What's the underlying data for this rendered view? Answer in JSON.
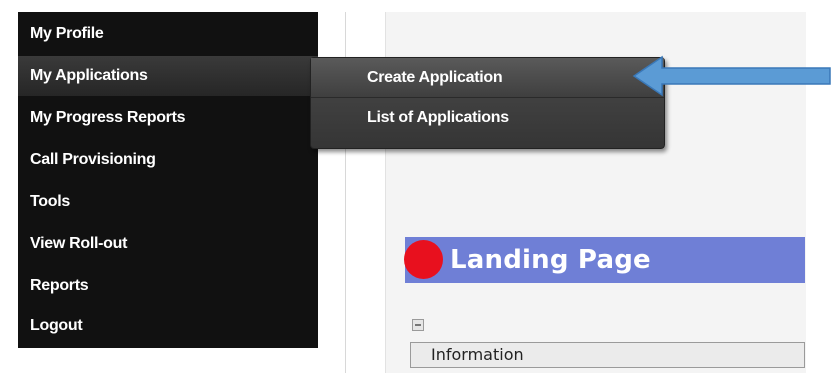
{
  "menu": {
    "items": [
      {
        "label": "My Profile"
      },
      {
        "label": "My Applications"
      },
      {
        "label": "My Progress Reports"
      },
      {
        "label": "Call Provisioning"
      },
      {
        "label": "Tools"
      },
      {
        "label": "View Roll-out"
      },
      {
        "label": "Reports"
      },
      {
        "label": "Logout"
      }
    ]
  },
  "submenu": {
    "items": [
      {
        "label": "Create Application"
      },
      {
        "label": "List of Applications"
      }
    ]
  },
  "content": {
    "title": "Landing Page",
    "section_label": "Information"
  },
  "colors": {
    "menu_bg": "#111111",
    "title_bar": "#6f7fd6",
    "dot": "#e8101e",
    "arrow": "#5b9bd5"
  },
  "icons": {
    "collapse": "collapse-minus-icon",
    "indicator": "pointer-arrow-icon"
  }
}
